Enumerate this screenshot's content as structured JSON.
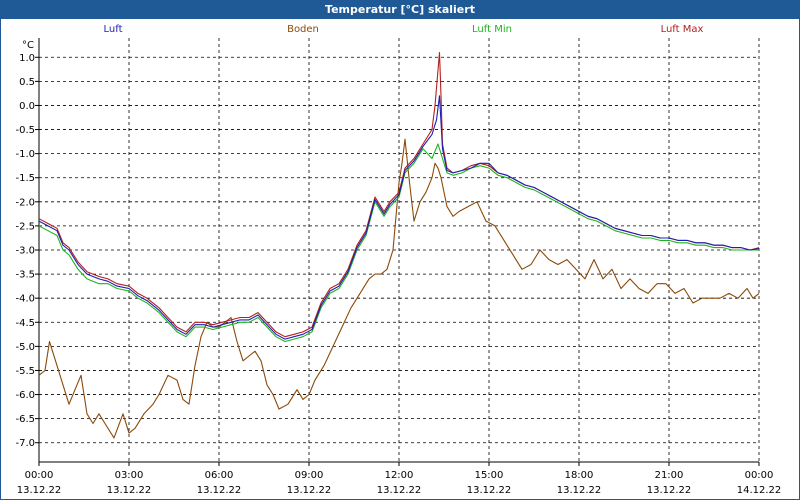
{
  "window": {
    "title": "Temperatur [°C] skaliert"
  },
  "legend": [
    {
      "label": "Luft",
      "color": "#1f1fb4"
    },
    {
      "label": "Boden",
      "color": "#8b4a0a"
    },
    {
      "label": "Luft Min",
      "color": "#1fb41f"
    },
    {
      "label": "Luft Max",
      "color": "#b41f1f"
    }
  ],
  "chart_data": {
    "type": "line",
    "title": "Temperatur [°C] skaliert",
    "ylabel": "°C",
    "xlabel": "",
    "ylim": [
      -7.4,
      1.4
    ],
    "xlim": [
      0,
      24
    ],
    "yticks": [
      1.0,
      0.5,
      0.0,
      -0.5,
      -1.0,
      -1.5,
      -2.0,
      -2.5,
      -3.0,
      -3.5,
      -4.0,
      -4.5,
      -5.0,
      -5.5,
      -6.0,
      -6.5,
      -7.0
    ],
    "ytick_labels": [
      "1.0",
      "0.5",
      "0.0",
      "-0.5",
      "-1.0",
      "-1.5",
      "-2.0",
      "-2.5",
      "-3.0",
      "-3.5",
      "-4.0",
      "-4.5",
      "-5.0",
      "-5.5",
      "-6.0",
      "-6.5",
      "-7.0"
    ],
    "xticks": [
      {
        "time": "00:00",
        "date": "13.12.22",
        "h": 0
      },
      {
        "time": "03:00",
        "date": "13.12.22",
        "h": 3
      },
      {
        "time": "06:00",
        "date": "13.12.22",
        "h": 6
      },
      {
        "time": "09:00",
        "date": "13.12.22",
        "h": 9
      },
      {
        "time": "12:00",
        "date": "13.12.22",
        "h": 12
      },
      {
        "time": "15:00",
        "date": "13.12.22",
        "h": 15
      },
      {
        "time": "18:00",
        "date": "13.12.22",
        "h": 18
      },
      {
        "time": "21:00",
        "date": "13.12.22",
        "h": 21
      },
      {
        "time": "00:00",
        "date": "14.12.22",
        "h": 24
      }
    ],
    "grid": true,
    "series": [
      {
        "name": "Boden",
        "color": "#8b4a0a",
        "x": [
          0,
          0.2,
          0.35,
          0.45,
          0.6,
          0.8,
          1.0,
          1.2,
          1.4,
          1.6,
          1.8,
          2.0,
          2.2,
          2.5,
          2.8,
          3.0,
          3.2,
          3.5,
          3.8,
          4.0,
          4.3,
          4.6,
          4.8,
          5.0,
          5.2,
          5.4,
          5.6,
          5.8,
          6.0,
          6.2,
          6.4,
          6.6,
          6.8,
          7.0,
          7.2,
          7.4,
          7.6,
          7.8,
          8.0,
          8.3,
          8.6,
          8.8,
          9.0,
          9.2,
          9.5,
          9.8,
          10.1,
          10.4,
          10.7,
          11.0,
          11.2,
          11.4,
          11.6,
          11.8,
          12.0,
          12.1,
          12.2,
          12.35,
          12.5,
          12.7,
          12.9,
          13.1,
          13.2,
          13.3,
          13.4,
          13.6,
          13.8,
          14.0,
          14.3,
          14.6,
          14.9,
          15.2,
          15.5,
          15.8,
          16.1,
          16.4,
          16.7,
          17.0,
          17.3,
          17.6,
          17.9,
          18.2,
          18.5,
          18.8,
          19.1,
          19.4,
          19.7,
          20.0,
          20.3,
          20.6,
          20.9,
          21.2,
          21.5,
          21.8,
          22.1,
          22.4,
          22.7,
          23.0,
          23.3,
          23.6,
          23.8,
          24.0
        ],
        "y": [
          -5.6,
          -5.5,
          -4.9,
          -5.1,
          -5.4,
          -5.8,
          -6.2,
          -5.9,
          -5.6,
          -6.4,
          -6.6,
          -6.4,
          -6.6,
          -6.9,
          -6.4,
          -6.8,
          -6.7,
          -6.4,
          -6.2,
          -6.0,
          -5.6,
          -5.7,
          -6.1,
          -6.2,
          -5.4,
          -4.8,
          -4.5,
          -4.6,
          -4.6,
          -4.5,
          -4.4,
          -4.9,
          -5.3,
          -5.2,
          -5.1,
          -5.3,
          -5.8,
          -6.0,
          -6.3,
          -6.2,
          -5.9,
          -6.1,
          -6.0,
          -5.7,
          -5.4,
          -5.0,
          -4.6,
          -4.2,
          -3.9,
          -3.6,
          -3.5,
          -3.5,
          -3.4,
          -3.0,
          -1.6,
          -1.2,
          -0.7,
          -1.6,
          -2.4,
          -2.0,
          -1.8,
          -1.5,
          -1.2,
          -1.3,
          -1.5,
          -2.1,
          -2.3,
          -2.2,
          -2.1,
          -2.0,
          -2.4,
          -2.5,
          -2.8,
          -3.1,
          -3.4,
          -3.3,
          -3.0,
          -3.2,
          -3.3,
          -3.2,
          -3.4,
          -3.6,
          -3.2,
          -3.6,
          -3.4,
          -3.8,
          -3.6,
          -3.8,
          -3.9,
          -3.7,
          -3.7,
          -3.9,
          -3.8,
          -4.1,
          -4.0,
          -4.0,
          -4.0,
          -3.9,
          -4.0,
          -3.8,
          -4.0,
          -3.9
        ]
      },
      {
        "name": "Luft Min",
        "color": "#1fb41f",
        "x": [
          0,
          0.3,
          0.6,
          0.8,
          1.0,
          1.3,
          1.6,
          2.0,
          2.3,
          2.6,
          3.0,
          3.3,
          3.6,
          4.0,
          4.3,
          4.6,
          4.9,
          5.2,
          5.5,
          5.8,
          6.1,
          6.4,
          6.7,
          7.0,
          7.3,
          7.6,
          7.9,
          8.2,
          8.5,
          8.8,
          9.1,
          9.4,
          9.7,
          10.0,
          10.3,
          10.6,
          10.9,
          11.2,
          11.5,
          11.7,
          12.0,
          12.2,
          12.5,
          12.8,
          13.1,
          13.3,
          13.45,
          13.6,
          13.8,
          14.1,
          14.4,
          14.7,
          15.0,
          15.3,
          15.6,
          15.9,
          16.2,
          16.5,
          16.8,
          17.1,
          17.4,
          17.7,
          18.0,
          18.3,
          18.6,
          18.9,
          19.2,
          19.5,
          19.8,
          20.1,
          20.4,
          20.7,
          21.0,
          21.3,
          21.6,
          21.9,
          22.2,
          22.5,
          22.8,
          23.1,
          23.4,
          23.7,
          24.0
        ],
        "y": [
          -2.5,
          -2.6,
          -2.7,
          -3.0,
          -3.1,
          -3.4,
          -3.6,
          -3.7,
          -3.7,
          -3.8,
          -3.85,
          -4.0,
          -4.1,
          -4.3,
          -4.5,
          -4.7,
          -4.8,
          -4.6,
          -4.6,
          -4.65,
          -4.6,
          -4.55,
          -4.5,
          -4.5,
          -4.4,
          -4.6,
          -4.8,
          -4.9,
          -4.85,
          -4.8,
          -4.7,
          -4.2,
          -3.9,
          -3.8,
          -3.5,
          -3.0,
          -2.7,
          -2.0,
          -2.3,
          -2.1,
          -1.9,
          -1.4,
          -1.2,
          -0.9,
          -1.1,
          -0.8,
          -1.1,
          -1.4,
          -1.45,
          -1.4,
          -1.3,
          -1.25,
          -1.3,
          -1.45,
          -1.5,
          -1.6,
          -1.7,
          -1.75,
          -1.85,
          -1.95,
          -2.05,
          -2.15,
          -2.25,
          -2.35,
          -2.4,
          -2.5,
          -2.6,
          -2.65,
          -2.7,
          -2.75,
          -2.75,
          -2.8,
          -2.8,
          -2.85,
          -2.85,
          -2.9,
          -2.9,
          -2.95,
          -2.95,
          -3.0,
          -3.0,
          -3.0,
          -3.0
        ]
      },
      {
        "name": "Luft Max",
        "color": "#b41f1f",
        "x": [
          0,
          0.3,
          0.6,
          0.8,
          1.0,
          1.3,
          1.6,
          2.0,
          2.3,
          2.6,
          3.0,
          3.3,
          3.6,
          4.0,
          4.3,
          4.6,
          4.9,
          5.2,
          5.5,
          5.8,
          6.1,
          6.4,
          6.7,
          7.0,
          7.3,
          7.6,
          7.9,
          8.2,
          8.5,
          8.8,
          9.1,
          9.4,
          9.7,
          10.0,
          10.3,
          10.6,
          10.9,
          11.2,
          11.5,
          11.7,
          12.0,
          12.2,
          12.5,
          12.8,
          13.1,
          13.2,
          13.35,
          13.4,
          13.45,
          13.6,
          13.8,
          14.1,
          14.4,
          14.7,
          15.0,
          15.3,
          15.6,
          15.9,
          16.2,
          16.5,
          16.8,
          17.1,
          17.4,
          17.7,
          18.0,
          18.3,
          18.6,
          18.9,
          19.2,
          19.5,
          19.8,
          20.1,
          20.4,
          20.7,
          21.0,
          21.3,
          21.6,
          21.9,
          22.2,
          22.5,
          22.8,
          23.1,
          23.4,
          23.7,
          24.0
        ],
        "y": [
          -2.35,
          -2.45,
          -2.55,
          -2.85,
          -2.95,
          -3.25,
          -3.45,
          -3.55,
          -3.6,
          -3.7,
          -3.75,
          -3.9,
          -4.0,
          -4.2,
          -4.4,
          -4.6,
          -4.7,
          -4.5,
          -4.5,
          -4.55,
          -4.5,
          -4.45,
          -4.4,
          -4.4,
          -4.3,
          -4.5,
          -4.7,
          -4.8,
          -4.75,
          -4.7,
          -4.6,
          -4.1,
          -3.8,
          -3.7,
          -3.4,
          -2.9,
          -2.6,
          -1.9,
          -2.2,
          -2.0,
          -1.8,
          -1.3,
          -1.1,
          -0.8,
          -0.5,
          0.0,
          1.1,
          0.2,
          -0.8,
          -1.3,
          -1.4,
          -1.35,
          -1.25,
          -1.2,
          -1.25,
          -1.4,
          -1.45,
          -1.55,
          -1.65,
          -1.7,
          -1.8,
          -1.9,
          -2.0,
          -2.1,
          -2.2,
          -2.3,
          -2.35,
          -2.45,
          -2.55,
          -2.6,
          -2.65,
          -2.7,
          -2.7,
          -2.75,
          -2.75,
          -2.8,
          -2.8,
          -2.85,
          -2.85,
          -2.9,
          -2.9,
          -2.95,
          -2.95,
          -3.0,
          -2.95
        ]
      },
      {
        "name": "Luft",
        "color": "#1f1fb4",
        "x": [
          0,
          0.3,
          0.6,
          0.8,
          1.0,
          1.3,
          1.6,
          2.0,
          2.3,
          2.6,
          3.0,
          3.3,
          3.6,
          4.0,
          4.3,
          4.6,
          4.9,
          5.2,
          5.5,
          5.8,
          6.1,
          6.4,
          6.7,
          7.0,
          7.3,
          7.6,
          7.9,
          8.2,
          8.5,
          8.8,
          9.1,
          9.4,
          9.7,
          10.0,
          10.3,
          10.6,
          10.9,
          11.2,
          11.5,
          11.7,
          12.0,
          12.2,
          12.5,
          12.8,
          13.1,
          13.25,
          13.35,
          13.45,
          13.6,
          13.8,
          14.1,
          14.4,
          14.7,
          15.0,
          15.3,
          15.6,
          15.9,
          16.2,
          16.5,
          16.8,
          17.1,
          17.4,
          17.7,
          18.0,
          18.3,
          18.6,
          18.9,
          19.2,
          19.5,
          19.8,
          20.1,
          20.4,
          20.7,
          21.0,
          21.3,
          21.6,
          21.9,
          22.2,
          22.5,
          22.8,
          23.1,
          23.4,
          23.7,
          24.0
        ],
        "y": [
          -2.4,
          -2.5,
          -2.6,
          -2.9,
          -3.0,
          -3.3,
          -3.5,
          -3.6,
          -3.65,
          -3.75,
          -3.8,
          -3.95,
          -4.05,
          -4.25,
          -4.45,
          -4.65,
          -4.75,
          -4.55,
          -4.55,
          -4.6,
          -4.55,
          -4.5,
          -4.45,
          -4.45,
          -4.35,
          -4.55,
          -4.75,
          -4.85,
          -4.8,
          -4.75,
          -4.65,
          -4.15,
          -3.85,
          -3.75,
          -3.45,
          -2.95,
          -2.65,
          -1.95,
          -2.25,
          -2.05,
          -1.85,
          -1.35,
          -1.15,
          -0.85,
          -0.6,
          -0.3,
          0.2,
          -0.9,
          -1.35,
          -1.4,
          -1.35,
          -1.3,
          -1.2,
          -1.2,
          -1.4,
          -1.45,
          -1.55,
          -1.65,
          -1.7,
          -1.8,
          -1.9,
          -2.0,
          -2.1,
          -2.2,
          -2.3,
          -2.35,
          -2.45,
          -2.55,
          -2.6,
          -2.65,
          -2.7,
          -2.7,
          -2.75,
          -2.75,
          -2.8,
          -2.8,
          -2.85,
          -2.85,
          -2.9,
          -2.9,
          -2.95,
          -2.95,
          -3.0,
          -2.97
        ]
      }
    ]
  }
}
